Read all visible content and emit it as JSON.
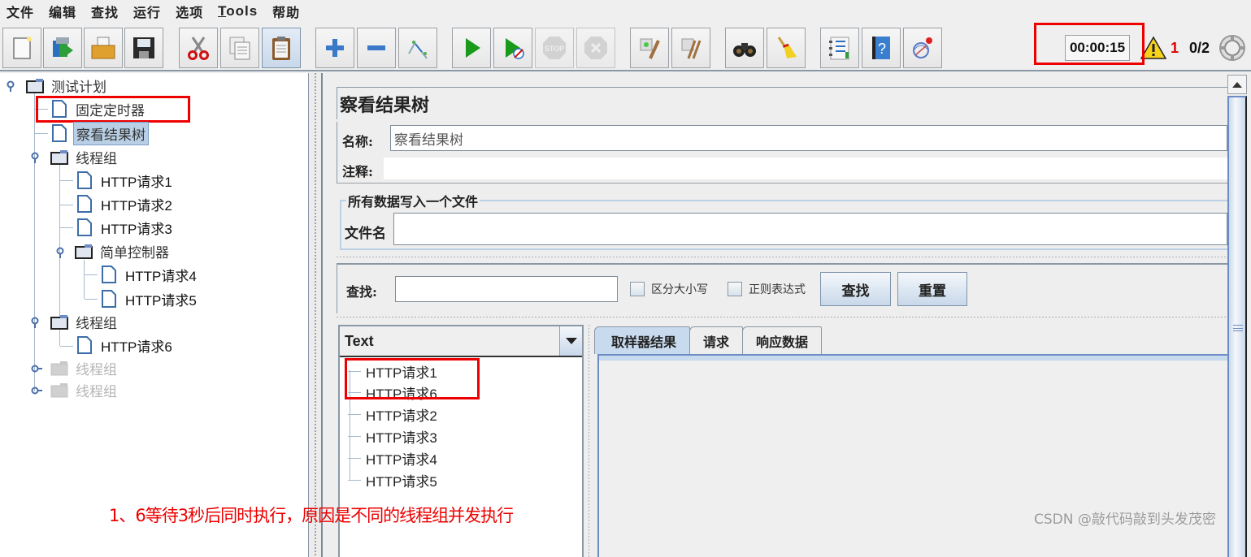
{
  "menu": [
    "文件",
    "编辑",
    "查找",
    "运行",
    "选项",
    "Tools",
    "帮助"
  ],
  "toolbar": {
    "buttons": [
      {
        "name": "new-plan",
        "icon": "new-document-icon"
      },
      {
        "name": "templates",
        "icon": "templates-icon"
      },
      {
        "name": "open",
        "icon": "open-folder-icon"
      },
      {
        "name": "save",
        "icon": "save-disk-icon"
      },
      {
        "name": "cut",
        "icon": "scissors-icon"
      },
      {
        "name": "copy",
        "icon": "copy-icon"
      },
      {
        "name": "paste",
        "icon": "clipboard-icon"
      },
      {
        "name": "expand",
        "icon": "plus-icon"
      },
      {
        "name": "collapse",
        "icon": "minus-icon"
      },
      {
        "name": "toggle",
        "icon": "toggle-icon"
      },
      {
        "name": "start",
        "icon": "play-icon"
      },
      {
        "name": "start-no-pauses",
        "icon": "play-no-timers-icon"
      },
      {
        "name": "stop",
        "icon": "stop-icon"
      },
      {
        "name": "shutdown",
        "icon": "shutdown-icon"
      },
      {
        "name": "clear",
        "icon": "clear-icon"
      },
      {
        "name": "clear-all",
        "icon": "clear-all-icon"
      },
      {
        "name": "search",
        "icon": "binoculars-icon"
      },
      {
        "name": "reset-search",
        "icon": "broom-icon"
      },
      {
        "name": "function-helper",
        "icon": "function-list-icon"
      },
      {
        "name": "help",
        "icon": "help-book-icon"
      },
      {
        "name": "remote",
        "icon": "remote-icon"
      }
    ],
    "timer": "00:00:15",
    "warning_count": "1",
    "threads": "0/2"
  },
  "tree": {
    "nodes": [
      {
        "label": "测试计划",
        "type": "folder",
        "level": 0,
        "expanded": true
      },
      {
        "label": "固定定时器",
        "type": "leaf",
        "level": 1
      },
      {
        "label": "察看结果树",
        "type": "leaf",
        "level": 1,
        "selected": true
      },
      {
        "label": "线程组",
        "type": "folder",
        "level": 1,
        "expanded": true
      },
      {
        "label": "HTTP请求1",
        "type": "leaf",
        "level": 2
      },
      {
        "label": "HTTP请求2",
        "type": "leaf",
        "level": 2
      },
      {
        "label": "HTTP请求3",
        "type": "leaf",
        "level": 2
      },
      {
        "label": "简单控制器",
        "type": "folder",
        "level": 2,
        "expanded": true
      },
      {
        "label": "HTTP请求4",
        "type": "leaf",
        "level": 3
      },
      {
        "label": "HTTP请求5",
        "type": "leaf",
        "level": 3
      },
      {
        "label": "线程组",
        "type": "folder",
        "level": 1,
        "expanded": true
      },
      {
        "label": "HTTP请求6",
        "type": "leaf",
        "level": 2
      },
      {
        "label": "线程组",
        "type": "folder",
        "level": 1,
        "disabled": true
      },
      {
        "label": "线程组",
        "type": "folder",
        "level": 1,
        "disabled": true
      }
    ]
  },
  "panel": {
    "title": "察看结果树",
    "name_label": "名称:",
    "name_value": "察看结果树",
    "comment_label": "注释:",
    "comment_value": "",
    "file_section_title": "所有数据写入一个文件",
    "filename_label": "文件名",
    "filename_value": "",
    "search_label": "查找:",
    "search_value": "",
    "case_sensitive_label": "区分大小写",
    "regex_label": "正则表达式",
    "find_button": "查找",
    "reset_button": "重置",
    "renderer_selected": "Text",
    "results": [
      "HTTP请求1",
      "HTTP请求6",
      "HTTP请求2",
      "HTTP请求3",
      "HTTP请求4",
      "HTTP请求5"
    ],
    "tabs": [
      "取样器结果",
      "请求",
      "响应数据"
    ],
    "active_tab": 0
  },
  "annotation": "1、6等待3秒后同时执行，原因是不同的线程组并发执行",
  "watermark": "CSDN @敲代码敲到头发茂密",
  "colors": {
    "annotation_red": "#ee0000",
    "selection_blue": "#b8cfe5",
    "tab_active": "#c8daee"
  }
}
